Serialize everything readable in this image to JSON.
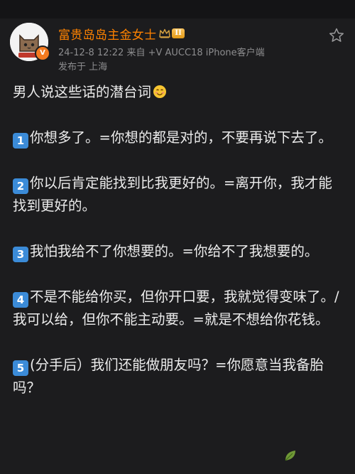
{
  "post": {
    "username": "富贵岛岛主金女士",
    "level_badge": "II",
    "vip_badge": "V",
    "meta": "24-12-8 12:22  来自 +V AUCC18 iPhone客户端",
    "location": "发布于 上海"
  },
  "content": {
    "title": "男人说这些话的潜台词",
    "items": [
      {
        "num": "1",
        "text": "你想多了。=你想的都是对的，不要再说下去了。"
      },
      {
        "num": "2",
        "text": "你以后肯定能找到比我更好的。=离开你，我才能找到更好的。"
      },
      {
        "num": "3",
        "text": "我怕我给不了你想要的。=你给不了我想要的。"
      },
      {
        "num": "4",
        "text": "不是不能给你买，但你开口要，我就觉得变味了。/我可以给，但你不能主动要。=就是不想给你花钱。"
      },
      {
        "num": "5",
        "text": "(分手后）我们还能做朋友吗？=你愿意当我备胎吗？"
      }
    ]
  },
  "icons": {
    "favorite": "star-outline-icon",
    "crown": "crown-icon",
    "emoji": "smiling-face-icon"
  },
  "colors": {
    "background": "#1c1c1e",
    "username": "#ff8200",
    "meta": "#8d8d8f",
    "keycap": "#3b8bd8",
    "text": "#ececec"
  }
}
